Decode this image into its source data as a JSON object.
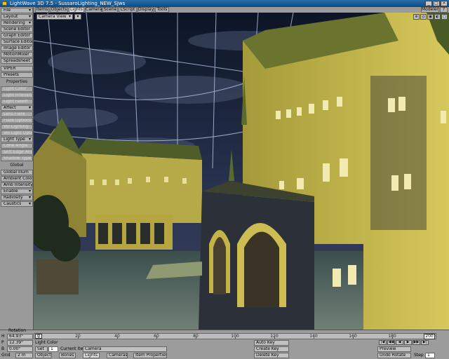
{
  "window": {
    "title": "LightWave 3D 7.5 - SussaroLighting_NEW_SJws",
    "minimize": "_",
    "maximize": "□",
    "close": "×"
  },
  "left_panel": {
    "items": [
      {
        "label": "File"
      },
      {
        "label": "Layout"
      },
      {
        "label": "Rendering"
      },
      {
        "label": "Scene Editor"
      },
      {
        "label": "Graph Editor"
      },
      {
        "label": "Surface Editor"
      },
      {
        "label": "Image Editor"
      },
      {
        "label": "MotionMixer"
      },
      {
        "label": "Spreadsheet"
      },
      {
        "label": "VIPER"
      },
      {
        "label": "Presets"
      }
    ],
    "properties_header": "Properties",
    "properties": [
      {
        "label": "Light Color"
      },
      {
        "label": "Light Intensity"
      },
      {
        "label": "Light Falloff"
      },
      {
        "label": "Affect"
      },
      {
        "label": "Lens Flare"
      },
      {
        "label": "Flare Options"
      },
      {
        "label": "Vol Lighting"
      },
      {
        "label": "Vol Light Options"
      },
      {
        "label": "Light Type"
      },
      {
        "label": "Cone Angle"
      },
      {
        "label": "Soft Edge Angle"
      },
      {
        "label": "Shadow Type"
      }
    ],
    "global_header": "Global",
    "global": [
      {
        "label": "Global Illum"
      },
      {
        "label": "Ambient Color"
      },
      {
        "label": "Amb Intensity"
      },
      {
        "label": "Enable"
      },
      {
        "label": "Radiosity"
      },
      {
        "label": "Caustics"
      }
    ]
  },
  "tabs": [
    {
      "label": "Items"
    },
    {
      "label": "Objects"
    },
    {
      "label": "Lights"
    },
    {
      "label": "Camera"
    },
    {
      "label": "Scene"
    },
    {
      "label": "LScript"
    },
    {
      "label": "Display"
    },
    {
      "label": "Tools"
    }
  ],
  "active_tab": "Lights",
  "modeler_button": "Modeler",
  "help_button": "?",
  "viewport": {
    "view_mode": "Camera View",
    "options": "▾",
    "icons": [
      "⊕",
      "◎",
      "▣",
      "◐",
      "▢"
    ]
  },
  "bottom": {
    "rotation_label": "Rotation",
    "h_label": "H",
    "p_label": "P",
    "b_label": "B",
    "h_value": "64.93°",
    "p_value": "12.39°",
    "b_value": "0.00°",
    "grid_label": "Grid",
    "grid_value": "2 m",
    "light_color_label": "Light Color",
    "set_button": "Set",
    "set_frame": "1",
    "current_item_label": "Current Item",
    "current_item_value": "Camera",
    "filter_buttons": [
      "Objects",
      "Bones",
      "Lights",
      "Cameras"
    ],
    "item_properties": "Item Properties",
    "auto_key": "Auto Key",
    "create_key": "Create Key",
    "delete_key": "Delete Key",
    "preview": "Preview",
    "undo_rotate": "Undo Rotate",
    "step_label": "Step",
    "step_value": "1",
    "slider_label": "0",
    "end_frame": "200",
    "play_buttons": [
      "|◀",
      "◀◀",
      "◀",
      "▶",
      "▶▶",
      "▶|"
    ]
  },
  "timeline": {
    "start": 0,
    "end": 200,
    "current": 0,
    "tick_labels": [
      "0",
      "20",
      "40",
      "60",
      "80",
      "100",
      "120",
      "140",
      "160",
      "180",
      "200"
    ]
  },
  "colors": {
    "sky": "#151d33",
    "facade": "#c8b84e",
    "roof": "#5a6b2c",
    "arch": "#2c3038",
    "window": "#f2eab0"
  }
}
